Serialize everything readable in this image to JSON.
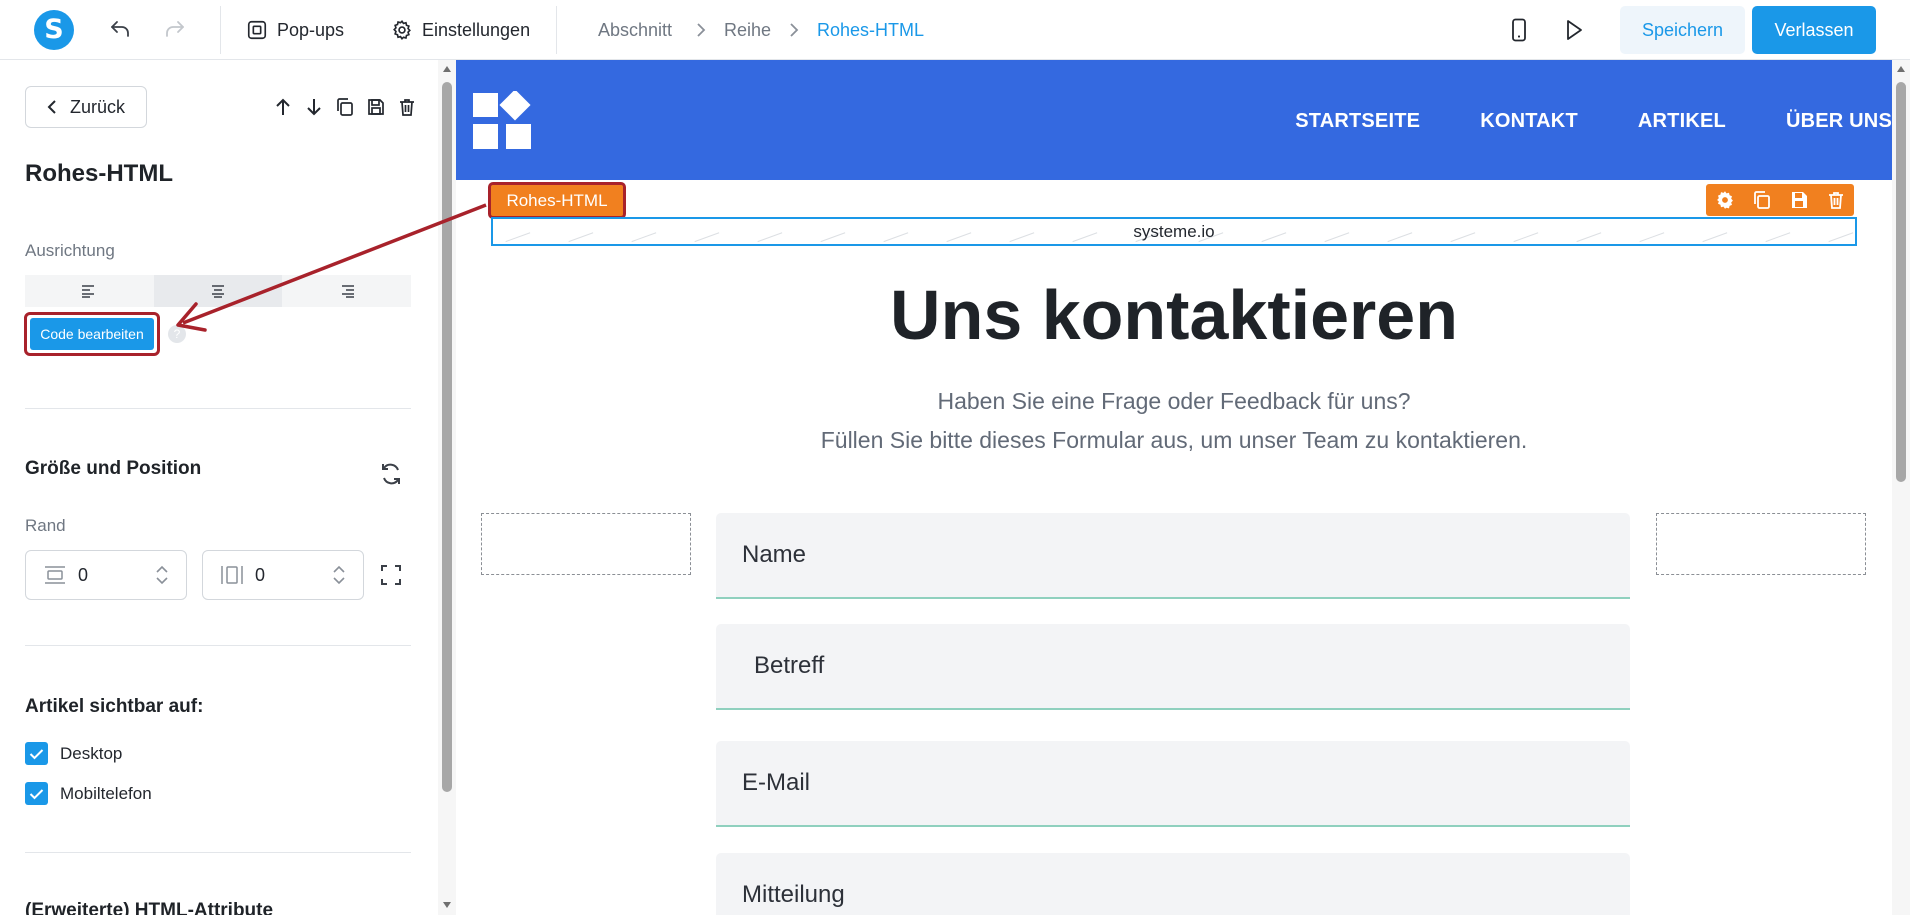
{
  "topbar": {
    "logo_letter": "S",
    "popups_label": "Pop-ups",
    "settings_label": "Einstellungen",
    "breadcrumb": [
      "Abschnitt",
      "Reihe",
      "Rohes-HTML"
    ],
    "save_label": "Speichern",
    "leave_label": "Verlassen"
  },
  "panel": {
    "back_label": "Zurück",
    "title": "Rohes-HTML",
    "alignment_label": "Ausrichtung",
    "alignment_selected": "center",
    "edit_code_label": "Code bearbeiten",
    "help_glyph": "?",
    "size_position_title": "Größe und Position",
    "margin_label": "Rand",
    "margin_vertical": "0",
    "margin_horizontal": "0",
    "visible_title": "Artikel sichtbar auf:",
    "visible_desktop": "Desktop",
    "visible_mobile": "Mobiltelefon",
    "advanced_title": "(Erweiterte) HTML-Attribute"
  },
  "canvas": {
    "nav": [
      "STARTSEITE",
      "KONTAKT",
      "ARTIKEL",
      "ÜBER UNS"
    ],
    "element_tag": "Rohes-HTML",
    "html_placeholder": "systeme.io",
    "heading": "Uns kontaktieren",
    "subheading_line1": "Haben Sie eine Frage oder Feedback für uns?",
    "subheading_line2": "Füllen Sie bitte dieses Formular aus, um unser Team zu kontaktieren.",
    "fields": {
      "name": "Name",
      "subject": "Betreff",
      "email": "E-Mail",
      "message": "Mitteilung"
    }
  },
  "colors": {
    "accent": "#1a98e8",
    "header_blue": "#3469e0",
    "element_orange": "#f1801f",
    "highlight_red": "#a8222b",
    "field_underline": "#8fd0be"
  },
  "icons": [
    "undo-icon",
    "redo-icon",
    "popups-icon",
    "gear-icon",
    "chevron-right-icon",
    "mobile-icon",
    "play-icon",
    "chevron-left-icon",
    "arrow-up-icon",
    "arrow-down-icon",
    "copy-icon",
    "save-icon",
    "trash-icon",
    "align-left-icon",
    "align-center-icon",
    "align-right-icon",
    "refresh-icon",
    "expand-icon",
    "checkbox-checked-icon"
  ]
}
